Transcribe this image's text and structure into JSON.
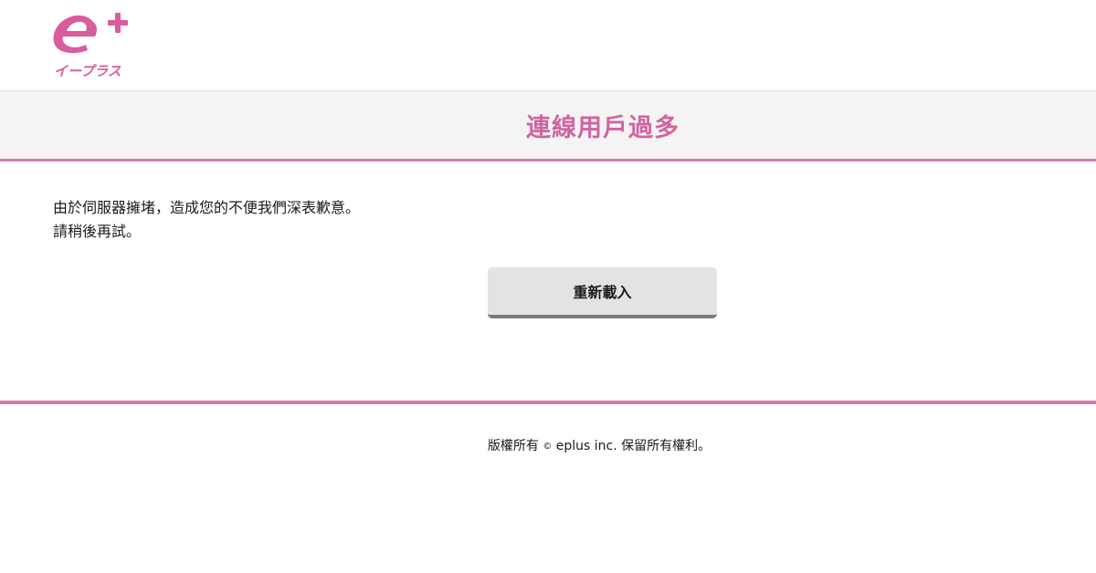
{
  "header": {
    "logo": {
      "mark": "e+",
      "kana": "イープラス",
      "icon": "eplus-logo"
    }
  },
  "page": {
    "title": "連線用戶過多"
  },
  "message": {
    "line1": "由於伺服器擁堵，造成您的不便我們深表歉意。",
    "line2": "請稍後再試。"
  },
  "actions": {
    "reload_label": "重新載入"
  },
  "footer": {
    "copyright_prefix": "版權所有",
    "copyright_symbol": "©",
    "copyright_suffix": "eplus inc. 保留所有權利。"
  },
  "colors": {
    "brand_pink": "#d95c9b",
    "title_pink": "#d064a0",
    "rule_pink": "#d877a8",
    "band_gray": "#f4f4f4",
    "button_gray": "#e3e3e3"
  }
}
